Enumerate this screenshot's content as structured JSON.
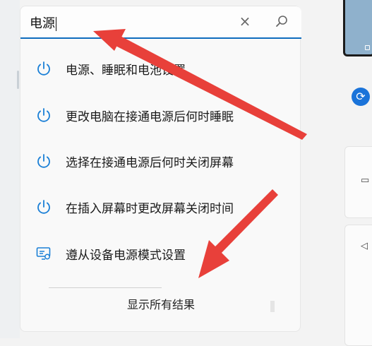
{
  "search": {
    "value": "电源"
  },
  "results": [
    {
      "label": "电源、睡眠和电池设置",
      "icon": "power-icon"
    },
    {
      "label": "更改电脑在接通电源后何时睡眠",
      "icon": "power-icon"
    },
    {
      "label": "选择在接通电源后何时关闭屏幕",
      "icon": "power-icon"
    },
    {
      "label": "在插入屏幕时更改屏幕关闭时间",
      "icon": "power-icon"
    },
    {
      "label": "遵从设备电源模式设置",
      "icon": "display-settings-icon"
    }
  ],
  "show_all": {
    "label": "显示所有结果"
  },
  "colors": {
    "accent": "#0f6cbd",
    "annotation_arrow": "#e8403a"
  }
}
